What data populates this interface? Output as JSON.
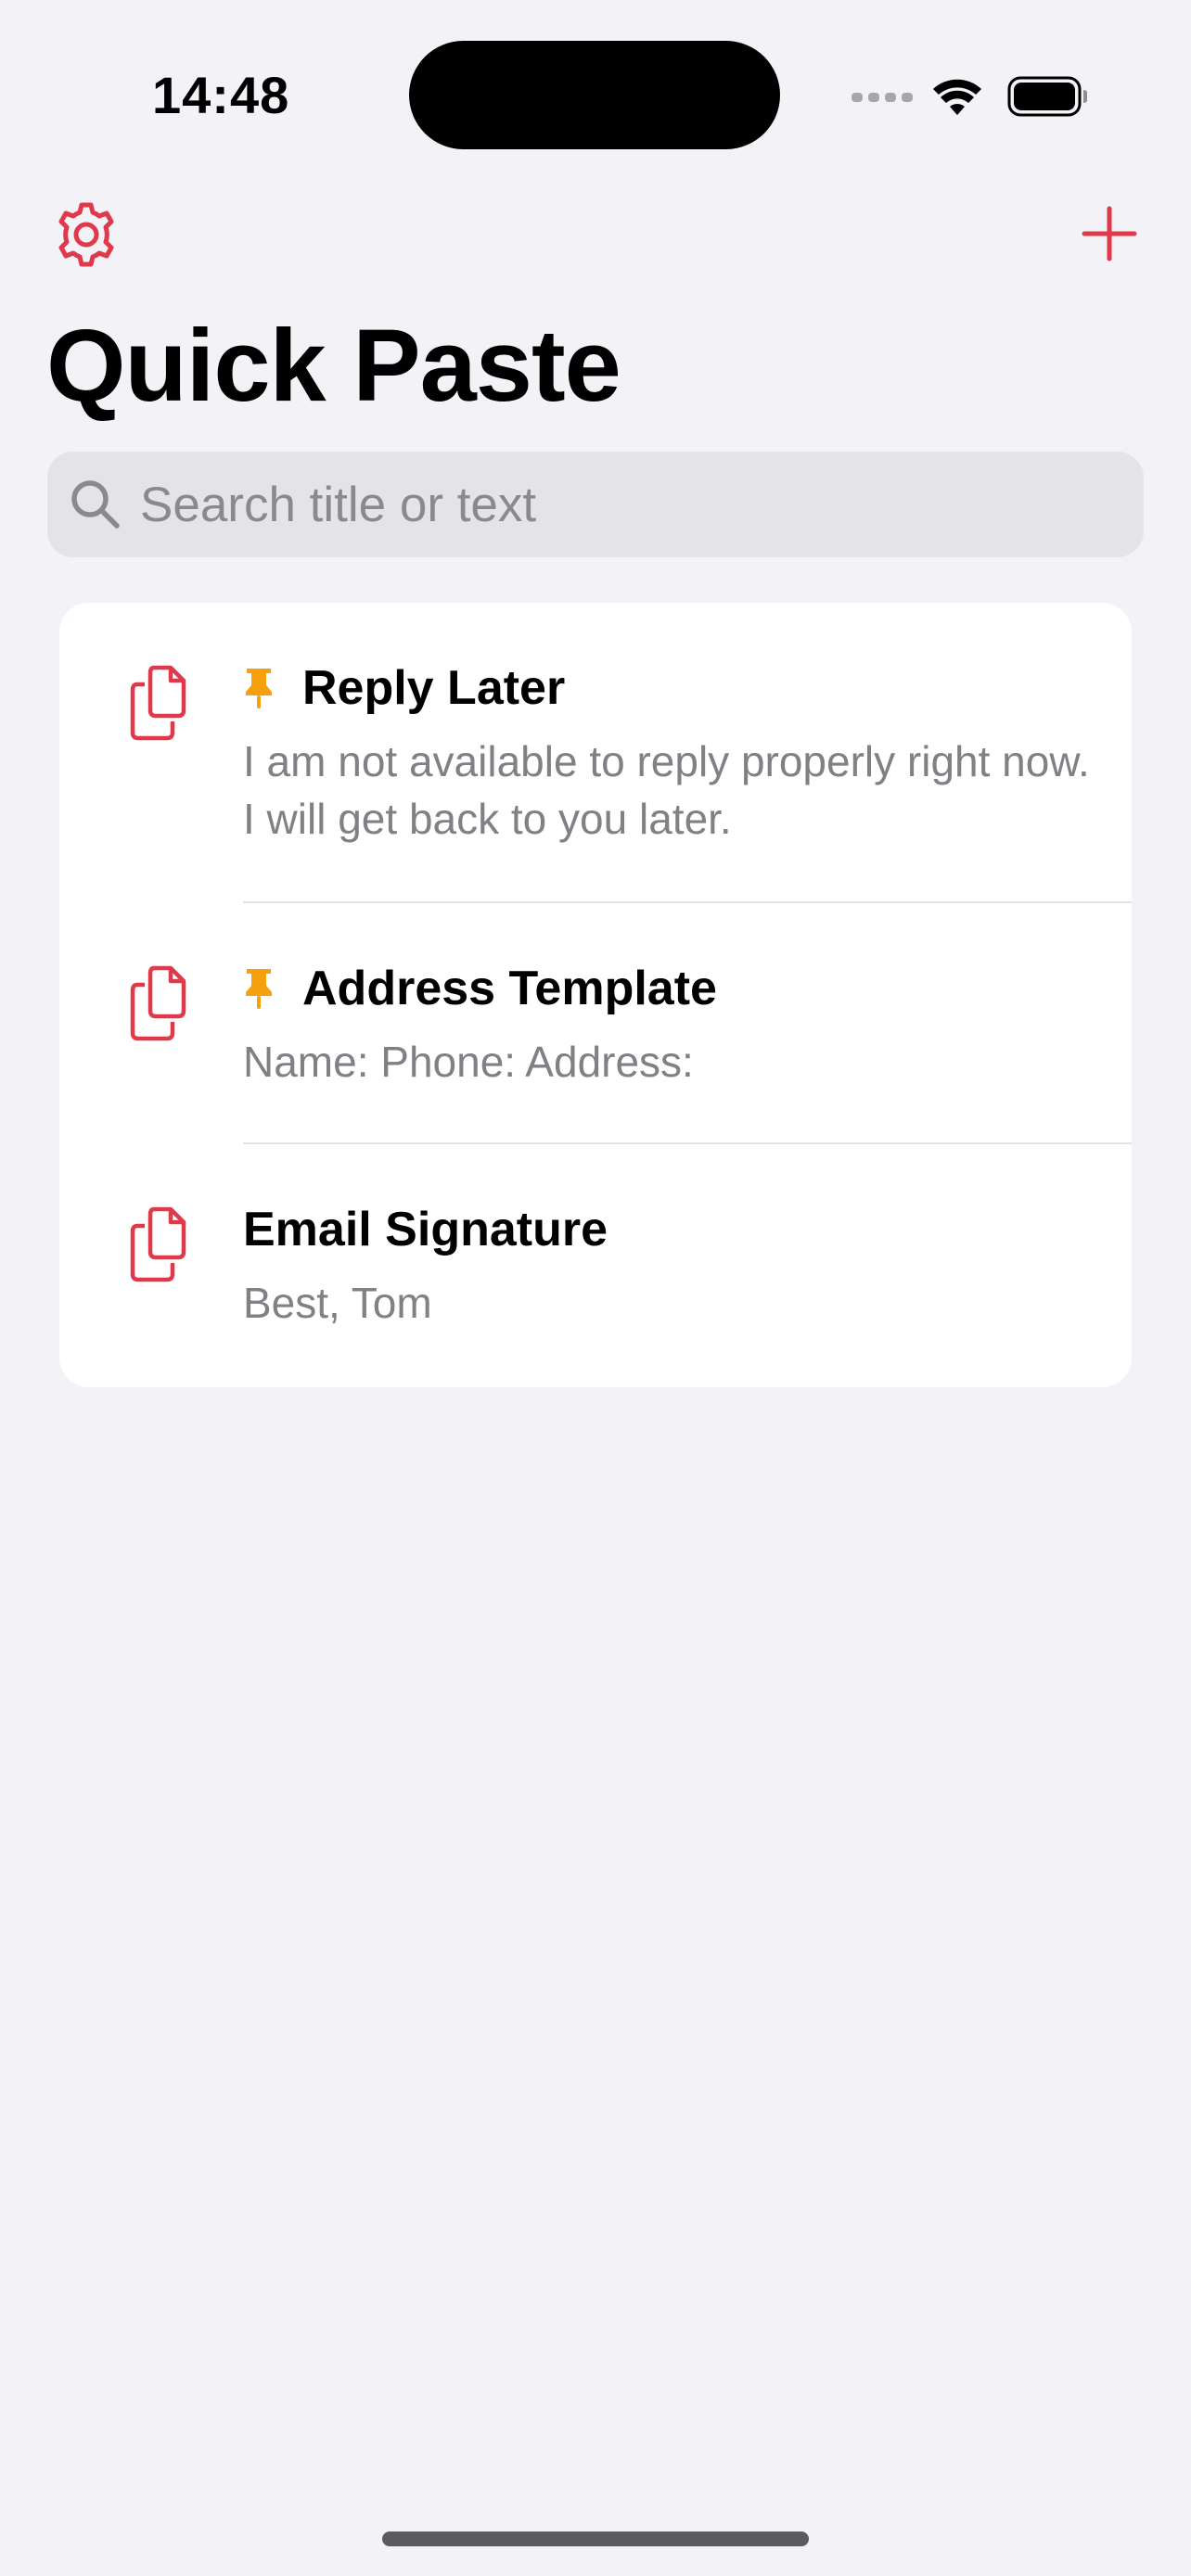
{
  "status_bar": {
    "time": "14:48"
  },
  "nav": {
    "settings_icon": "gear-icon",
    "add_icon": "plus-icon"
  },
  "page": {
    "title": "Quick Paste"
  },
  "search": {
    "placeholder": "Search title or text",
    "value": ""
  },
  "items": [
    {
      "title": "Reply Later",
      "text": "I am not available to reply properly right now. I will get back to you later.",
      "pinned": true
    },
    {
      "title": "Address Template",
      "text": "Name: Phone: Address:",
      "pinned": true
    },
    {
      "title": "Email Signature",
      "text": "Best, Tom",
      "pinned": false
    }
  ],
  "colors": {
    "accent": "#E0394B",
    "pin": "#F5A00C",
    "background": "#F2F2F7",
    "secondary_text": "#808085"
  }
}
